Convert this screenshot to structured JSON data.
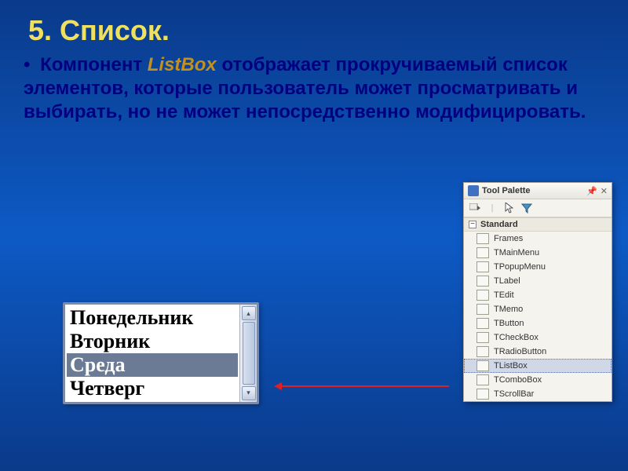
{
  "slide": {
    "title": "5. Список.",
    "bullet": "•",
    "text_before": "Компонент ",
    "listbox_word": "ListBox",
    "text_after": " отображает прокручиваемый список элементов, которые пользователь может просматривать и выбирать, но не может непосредственно модифицировать."
  },
  "listbox": {
    "items": [
      "Понедельник",
      "Вторник",
      "Среда",
      "Четверг"
    ],
    "selected_index": 2
  },
  "palette": {
    "title": "Tool Palette",
    "pin_glyph": "📌",
    "close_glyph": "✕",
    "category": "Standard",
    "minus": "−",
    "items": [
      {
        "label": "Frames"
      },
      {
        "label": "TMainMenu"
      },
      {
        "label": "TPopupMenu"
      },
      {
        "label": "TLabel"
      },
      {
        "label": "TEdit"
      },
      {
        "label": "TMemo"
      },
      {
        "label": "TButton"
      },
      {
        "label": "TCheckBox"
      },
      {
        "label": "TRadioButton"
      },
      {
        "label": "TListBox"
      },
      {
        "label": "TComboBox"
      },
      {
        "label": "TScrollBar"
      }
    ],
    "highlight_index": 9
  }
}
